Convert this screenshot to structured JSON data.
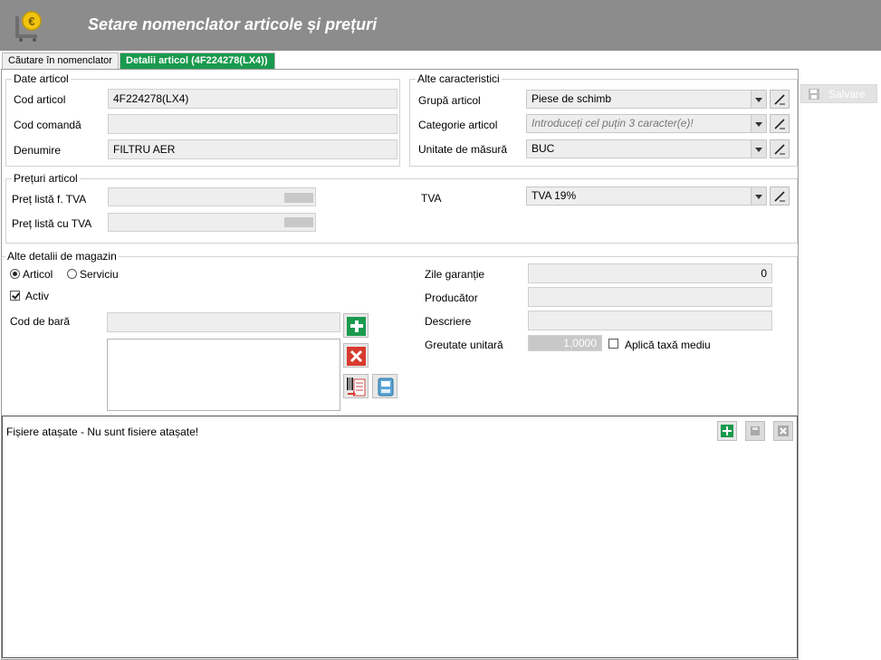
{
  "header": {
    "title": "Setare nomenclator articole și prețuri",
    "logo_icon": "euro-coin-cart-icon"
  },
  "tabs": [
    {
      "label": "Căutare în nomenclator"
    },
    {
      "label": "Detalii articol (4F224278(LX4))"
    }
  ],
  "toolbar": {
    "save_label": "Salvare"
  },
  "date_articol": {
    "legend": "Date articol",
    "cod_articol": {
      "label": "Cod articol",
      "value": "4F224278(LX4)"
    },
    "cod_comanda": {
      "label": "Cod comandă",
      "value": ""
    },
    "denumire": {
      "label": "Denumire",
      "value": "FILTRU AER"
    }
  },
  "alte_caracteristici": {
    "legend": "Alte caracteristici",
    "grupa": {
      "label": "Grupă articol",
      "value": "Piese de schimb"
    },
    "categorie": {
      "label": "Categorie articol",
      "placeholder": "Introduceți cel puțin 3 caracter(e)!"
    },
    "unitate": {
      "label": "Unitate de măsură",
      "value": "BUC"
    }
  },
  "preturi": {
    "legend": "Prețuri articol",
    "fara_tva": {
      "label": "Preț listă f. TVA"
    },
    "cu_tva": {
      "label": "Preț listă cu TVA"
    },
    "tva": {
      "label": "TVA",
      "value": "TVA 19%"
    }
  },
  "magazin": {
    "legend": "Alte detalii de magazin",
    "tip_articol": "Articol",
    "tip_serviciu": "Serviciu",
    "activ": "Activ",
    "cod_bara": {
      "label": "Cod de bară",
      "value": ""
    },
    "zile_garantie": {
      "label": "Zile garanție",
      "value": "0"
    },
    "producator": {
      "label": "Producător",
      "value": ""
    },
    "descriere": {
      "label": "Descriere",
      "value": ""
    },
    "greutate": {
      "label": "Greutate unitară",
      "value": "1,0000"
    },
    "taxa_mediu": "Aplică taxă mediu"
  },
  "fisiere": {
    "title": "Fișiere atașate - Nu sunt fisiere atașate!"
  },
  "colors": {
    "header_bg": "#8c8c8c",
    "active_tab": "#1a9a4e",
    "add_green": "#1a9a4e",
    "delete_red": "#d83a2e"
  }
}
